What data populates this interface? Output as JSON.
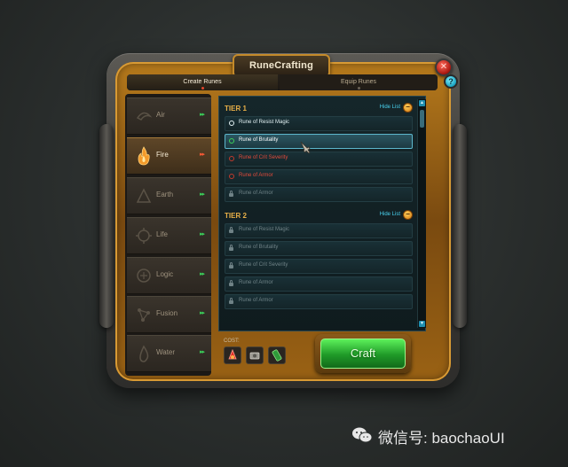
{
  "window": {
    "title": "RuneCrafting",
    "close_glyph": "✕",
    "help_glyph": "?"
  },
  "tabs": [
    {
      "label": "Create Runes",
      "active": true
    },
    {
      "label": "Equip Runes",
      "active": false
    }
  ],
  "elements": [
    {
      "label": "Air",
      "icon": "air-icon",
      "arrow": "▸▸",
      "active": false
    },
    {
      "label": "Fire",
      "icon": "fire-icon",
      "arrow": "▸▸",
      "active": true
    },
    {
      "label": "Earth",
      "icon": "earth-icon",
      "arrow": "▸▸",
      "active": false
    },
    {
      "label": "Life",
      "icon": "life-icon",
      "arrow": "▸▸",
      "active": false
    },
    {
      "label": "Logic",
      "icon": "logic-icon",
      "arrow": "▸▸",
      "active": false
    },
    {
      "label": "Fusion",
      "icon": "fusion-icon",
      "arrow": "▸▸",
      "active": false
    },
    {
      "label": "Water",
      "icon": "water-icon",
      "arrow": "▸▸",
      "active": false
    }
  ],
  "tiers": [
    {
      "title": "TIER 1",
      "hide_label": "Hide List",
      "runes": [
        {
          "name": "Rune of Resist Magic",
          "state": "available"
        },
        {
          "name": "Rune of Brutality",
          "state": "selected"
        },
        {
          "name": "Rune of Crit Severity",
          "state": "unavailable"
        },
        {
          "name": "Rune of Armor",
          "state": "unavailable"
        },
        {
          "name": "Rune of Armor",
          "state": "locked"
        }
      ]
    },
    {
      "title": "TIER 2",
      "hide_label": "Hide List",
      "runes": [
        {
          "name": "Rune of Resist Magic",
          "state": "locked"
        },
        {
          "name": "Rune of Brutality",
          "state": "locked"
        },
        {
          "name": "Rune of Crit Severity",
          "state": "locked"
        },
        {
          "name": "Rune of Armor",
          "state": "locked"
        },
        {
          "name": "Rune of Armor",
          "state": "locked"
        }
      ]
    }
  ],
  "cost": {
    "label": "COST:",
    "items": [
      "red-crystal-icon",
      "metal-gear-icon",
      "green-battery-icon"
    ]
  },
  "craft": {
    "label": "Craft"
  },
  "watermark": {
    "text": "微信号: baochaoUI"
  },
  "colors": {
    "gold": "#c48a2a",
    "craft_green": "#2fbf36",
    "tier_heading": "#e9b048",
    "link_cyan": "#49d2ef",
    "unavailable_red": "#e34a3a"
  }
}
